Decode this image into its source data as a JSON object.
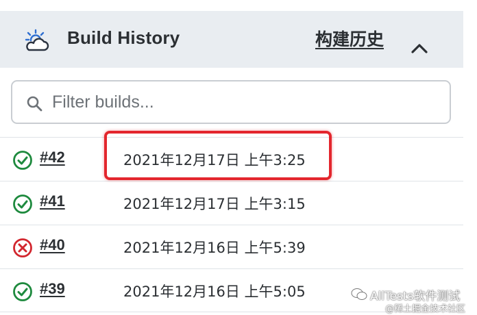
{
  "header": {
    "title": "Build History",
    "cn_link": "构建历史",
    "weather_icon": "partly-cloudy-weather-icon",
    "collapse_icon": "chevron-up-icon"
  },
  "filter": {
    "placeholder": "Filter builds...",
    "value": "",
    "icon": "search-icon"
  },
  "builds": [
    {
      "number": "#42",
      "time": "2021年12月17日 上午3:25",
      "status": "success",
      "highlighted": true
    },
    {
      "number": "#41",
      "time": "2021年12月17日 上午3:15",
      "status": "success",
      "highlighted": false
    },
    {
      "number": "#40",
      "time": "2021年12月16日 上午5:39",
      "status": "failed",
      "highlighted": false
    },
    {
      "number": "#39",
      "time": "2021年12月16日 上午5:05",
      "status": "success",
      "highlighted": false
    }
  ],
  "colors": {
    "header_bg": "#e9edf1",
    "success": "#1e8a3e",
    "failed": "#d2262e",
    "highlight": "#e3262d"
  },
  "watermark": {
    "main": "AllTests软件测试",
    "sub": "@稀土掘金技术社区"
  }
}
